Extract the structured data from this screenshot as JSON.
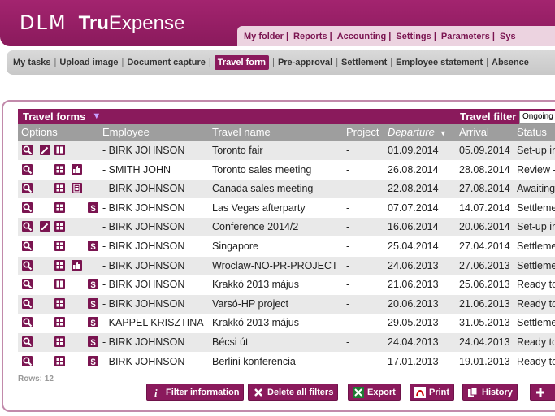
{
  "brand": {
    "dlm": "DLM",
    "tru": "Tru",
    "expense": "Expense"
  },
  "topnav": [
    {
      "label": "My folder |",
      "active": true
    },
    {
      "label": "Reports |"
    },
    {
      "label": "Accounting |"
    },
    {
      "label": "Settings |"
    },
    {
      "label": "Parameters |"
    },
    {
      "label": "Sys"
    }
  ],
  "subnav": [
    {
      "label": "My tasks"
    },
    {
      "label": "Upload image"
    },
    {
      "label": "Document capture"
    },
    {
      "label": "Travel form",
      "active": true
    },
    {
      "label": "Pre-approval"
    },
    {
      "label": "Settlement"
    },
    {
      "label": "Employee statement"
    },
    {
      "label": "Absence"
    }
  ],
  "grid": {
    "title": "Travel forms",
    "filter_label": "Travel filter",
    "filter_value": "Ongoing"
  },
  "columns": {
    "options": "Options",
    "employee": "Employee",
    "travel_name": "Travel name",
    "project": "Project",
    "departure": "Departure",
    "arrival": "Arrival",
    "status": "Status"
  },
  "rows": [
    {
      "icons": [
        "view",
        "edit",
        "grid"
      ],
      "employee": "- BIRK JOHNSON",
      "travel": "Toronto fair",
      "project": "-",
      "departure": "01.09.2014",
      "arrival": "05.09.2014",
      "status": "Set-up in"
    },
    {
      "icons": [
        "view",
        "",
        "grid",
        "thumb"
      ],
      "employee": "- SMITH JOHN",
      "travel": "Toronto sales meeting",
      "project": "-",
      "departure": "26.08.2014",
      "arrival": "28.08.2014",
      "status": "Review -"
    },
    {
      "icons": [
        "view",
        "",
        "grid",
        "doc"
      ],
      "employee": "- BIRK JOHNSON",
      "travel": "Canada sales meeting",
      "project": "-",
      "departure": "22.08.2014",
      "arrival": "27.08.2014",
      "status": "Awaiting"
    },
    {
      "icons": [
        "view",
        "",
        "grid",
        "",
        "money"
      ],
      "employee": "- BIRK JOHNSON",
      "travel": "Las Vegas afterparty",
      "project": "-",
      "departure": "07.07.2014",
      "arrival": "14.07.2014",
      "status": "Settleme"
    },
    {
      "icons": [
        "view",
        "edit",
        "grid"
      ],
      "employee": "- BIRK JOHNSON",
      "travel": "Conference 2014/2",
      "project": "-",
      "departure": "16.06.2014",
      "arrival": "20.06.2014",
      "status": "Set-up in"
    },
    {
      "icons": [
        "view",
        "",
        "grid",
        "",
        "money"
      ],
      "employee": "- BIRK JOHNSON",
      "travel": "Singapore",
      "project": "-",
      "departure": "25.04.2014",
      "arrival": "27.04.2014",
      "status": "Settleme"
    },
    {
      "icons": [
        "view",
        "",
        "grid",
        "thumb"
      ],
      "employee": "- BIRK JOHNSON",
      "travel": "Wroclaw-NO-PR-PROJECT",
      "project": "-",
      "departure": "24.06.2013",
      "arrival": "27.06.2013",
      "status": "Settleme"
    },
    {
      "icons": [
        "view",
        "",
        "grid",
        "",
        "money"
      ],
      "employee": "- BIRK JOHNSON",
      "travel": "Krakkó 2013 május",
      "project": "-",
      "departure": "21.06.2013",
      "arrival": "25.06.2013",
      "status": "Ready to"
    },
    {
      "icons": [
        "view",
        "",
        "grid",
        "",
        "money"
      ],
      "employee": "- BIRK JOHNSON",
      "travel": "Varsó-HP project",
      "project": "-",
      "departure": "20.06.2013",
      "arrival": "21.06.2013",
      "status": "Ready to"
    },
    {
      "icons": [
        "view",
        "",
        "grid",
        "",
        "money"
      ],
      "employee": "- KAPPEL KRISZTINA",
      "travel": "Krakkó 2013 május",
      "project": "-",
      "departure": "29.05.2013",
      "arrival": "31.05.2013",
      "status": "Settleme"
    },
    {
      "icons": [
        "view",
        "",
        "grid",
        "",
        "money"
      ],
      "employee": "- BIRK JOHNSON",
      "travel": "Bécsi út",
      "project": "-",
      "departure": "24.04.2013",
      "arrival": "24.04.2013",
      "status": "Ready to"
    },
    {
      "icons": [
        "view",
        "",
        "grid",
        "",
        "money"
      ],
      "employee": "- BIRK JOHNSON",
      "travel": "Berlini konferencia",
      "project": "-",
      "departure": "17.01.2013",
      "arrival": "19.01.2013",
      "status": "Ready to"
    }
  ],
  "rows_count": "Rows: 12",
  "buttons": {
    "filter_info": "Filter information",
    "delete_filters": "Delete all filters",
    "export": "Export",
    "print": "Print",
    "history": "History"
  },
  "colors": {
    "accent": "#8a1a5c",
    "header_bg": "#9e9e9e",
    "row_alt": "#e9e9e9"
  }
}
